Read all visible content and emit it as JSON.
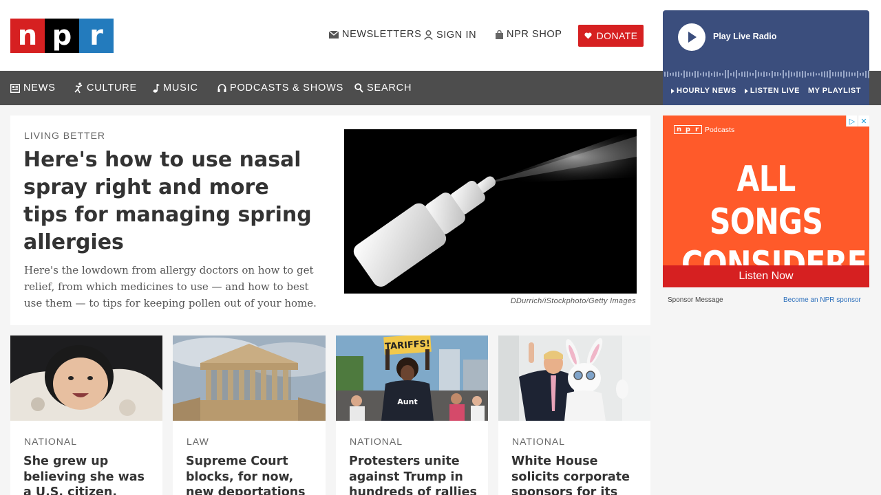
{
  "header": {
    "logo_letters": [
      "n",
      "p",
      "r"
    ],
    "newsletters": "NEWSLETTERS",
    "sign_in": "SIGN IN",
    "shop": "NPR SHOP",
    "donate": "DONATE"
  },
  "nav": {
    "items": [
      {
        "label": "NEWS",
        "icon": "news-icon"
      },
      {
        "label": "CULTURE",
        "icon": "culture-icon"
      },
      {
        "label": "MUSIC",
        "icon": "music-note-icon"
      },
      {
        "label": "PODCASTS & SHOWS",
        "icon": "headphones-icon"
      },
      {
        "label": "SEARCH",
        "icon": "search-icon"
      }
    ]
  },
  "player": {
    "play_label": "Play Live Radio",
    "links": [
      "HOURLY NEWS",
      "LISTEN LIVE",
      "MY PLAYLIST"
    ]
  },
  "feature": {
    "slug": "LIVING BETTER",
    "title": "Here's how to use nasal spray right and more tips for managing spring allergies",
    "teaser": "Here's the lowdown from allergy doctors on how to get relief, from which medicines to use — and how to best use them — to tips for keeping pollen out of your home.",
    "credit": "DDurrich/iStockphoto/Getty Images"
  },
  "ad": {
    "brand": "Podcasts",
    "title_line1": "ALL SONGS",
    "title_line2": "CONSIDERED",
    "cta": "Listen Now",
    "sponsor_message": "Sponsor Message",
    "sponsor_link": "Become an NPR sponsor",
    "colors": {
      "background": "#ff5a2a",
      "cta": "#d62021"
    }
  },
  "cards": [
    {
      "slug": "NATIONAL",
      "title": "She grew up believing she was a U.S. citizen. Then she"
    },
    {
      "slug": "LAW",
      "title": "Supreme Court blocks, for now, new deportations under"
    },
    {
      "slug": "NATIONAL",
      "title": "Protesters unite against Trump in hundreds of rallies"
    },
    {
      "slug": "NATIONAL",
      "title": "White House solicits corporate sponsors for its Easter Egg"
    }
  ],
  "images": {
    "protest_sign": "TARIFFS!",
    "shirt_text": "Aunt"
  },
  "colors": {
    "npr_red": "#d62021",
    "npr_blue": "#237bbd",
    "nav_bg": "#4d4d4d",
    "player_bg": "#3b4e7d"
  }
}
